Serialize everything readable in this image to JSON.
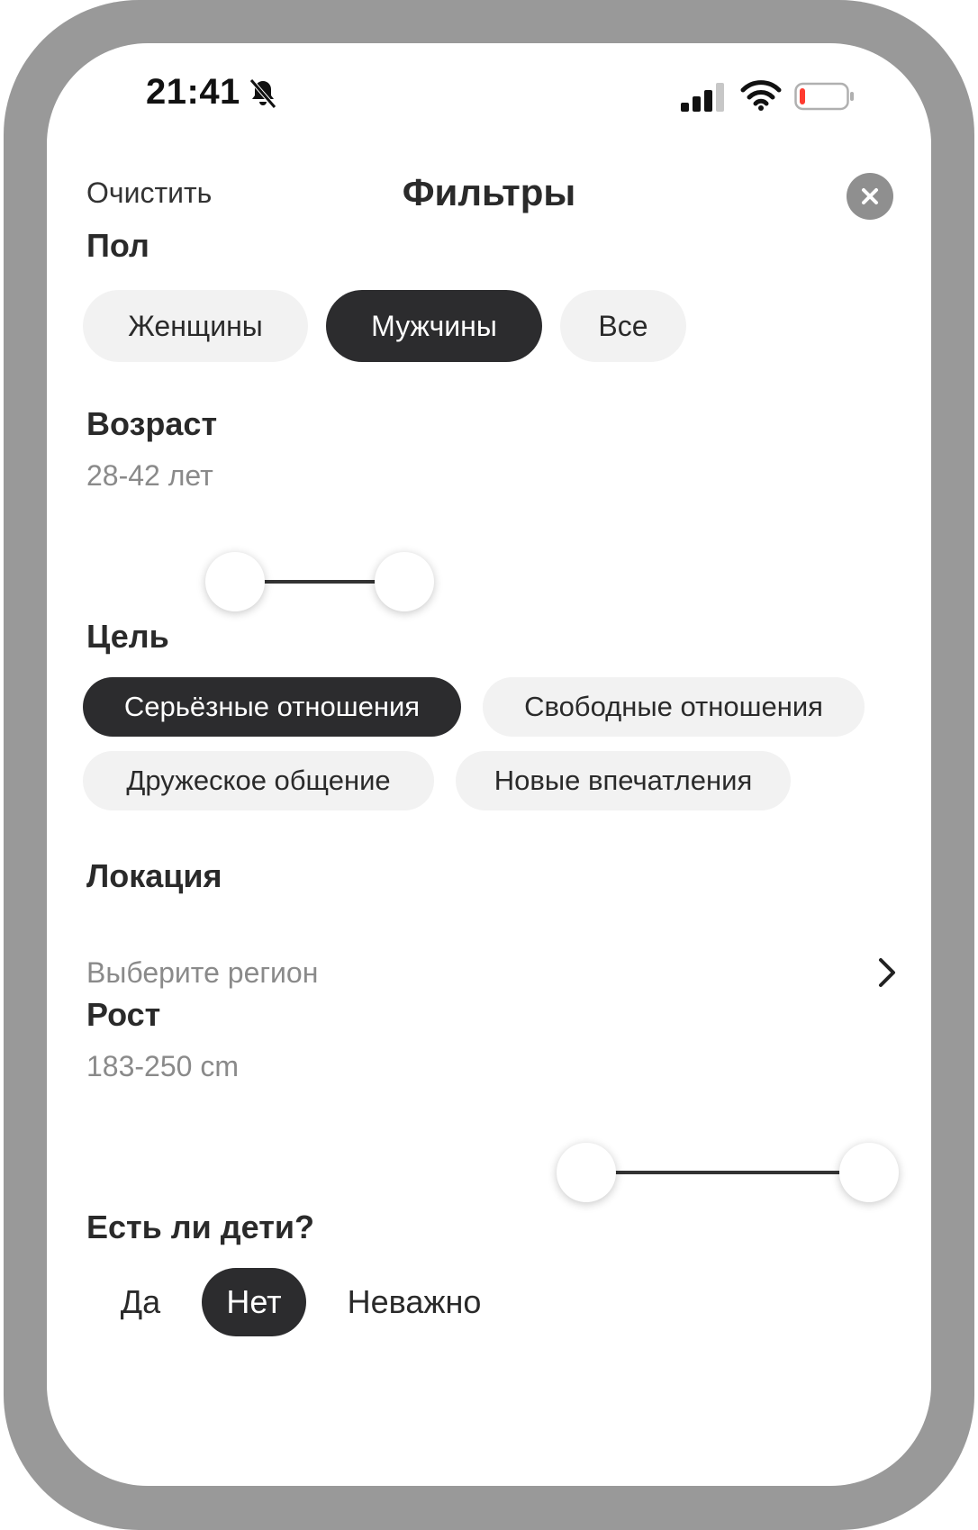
{
  "status_bar": {
    "time": "21:41",
    "icons": [
      "bell-slash-icon",
      "cellular-signal-icon",
      "wifi-icon",
      "battery-low-icon"
    ],
    "battery_color": "#ff3b30"
  },
  "header": {
    "clear_label": "Очистить",
    "title": "Фильтры",
    "close_icon": "close-icon"
  },
  "gender": {
    "title": "Пол",
    "options": [
      "Женщины",
      "Мужчины",
      "Все"
    ],
    "selected": "Мужчины"
  },
  "age": {
    "title": "Возраст",
    "value_text": "28-42 лет",
    "range": [
      28,
      42
    ]
  },
  "goal": {
    "title": "Цель",
    "options": [
      "Серьёзные отношения",
      "Свободные отношения",
      "Дружеское общение",
      "Новые впечатления"
    ],
    "selected": "Серьёзные отношения"
  },
  "location": {
    "title": "Локация",
    "placeholder": "Выберите регион",
    "icon": "chevron-right-icon"
  },
  "height": {
    "title": "Рост",
    "value_text": "183-250 cm",
    "range": [
      183,
      250
    ]
  },
  "children": {
    "title": "Есть ли дети?",
    "options": [
      "Да",
      "Нет",
      "Неважно"
    ],
    "selected": "Нет"
  },
  "colors": {
    "accent_dark": "#2c2c2e",
    "chip_bg": "#f2f2f2",
    "frame": "#999999"
  }
}
